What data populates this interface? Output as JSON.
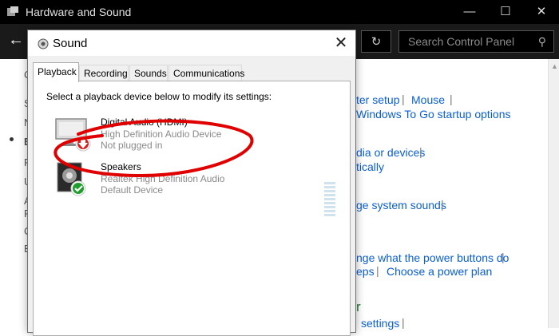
{
  "background_window": {
    "title": "Hardware and Sound",
    "search_placeholder": "Search Control Panel",
    "links": {
      "setup": "ter setup",
      "mouse": "Mouse",
      "windows_to_go": "Windows To Go startup options",
      "media_devices": "dia or devices",
      "automatically": "tically",
      "system_sounds": "ge system sounds",
      "power_buttons": "nge what the power buttons do",
      "eps": "eps",
      "power_plan": "Choose a power plan",
      "settings": "settings"
    },
    "heading_fragment": "r",
    "left_fragments": [
      "C",
      "S",
      "N",
      "E",
      "P",
      "U",
      "A",
      "P",
      "C",
      "E"
    ]
  },
  "dialog": {
    "title": "Sound",
    "tabs": [
      {
        "label": "Playback",
        "active": true
      },
      {
        "label": "Recording",
        "active": false
      },
      {
        "label": "Sounds",
        "active": false
      },
      {
        "label": "Communications",
        "active": false
      }
    ],
    "instruction": "Select a playback device below to modify its settings:",
    "devices": [
      {
        "name": "Digital Audio (HDMI)",
        "driver": "High Definition Audio Device",
        "status": "Not plugged in",
        "icon": "monitor-icon",
        "badge": "red-down-arrow-icon"
      },
      {
        "name": "Speakers",
        "driver": "Realtek High Definition Audio",
        "status": "Default Device",
        "icon": "speaker-icon",
        "badge": "green-check-icon"
      }
    ]
  },
  "colors": {
    "link": "#0a5fd3",
    "highlight": "#e00000",
    "titlebar": "#000000"
  }
}
